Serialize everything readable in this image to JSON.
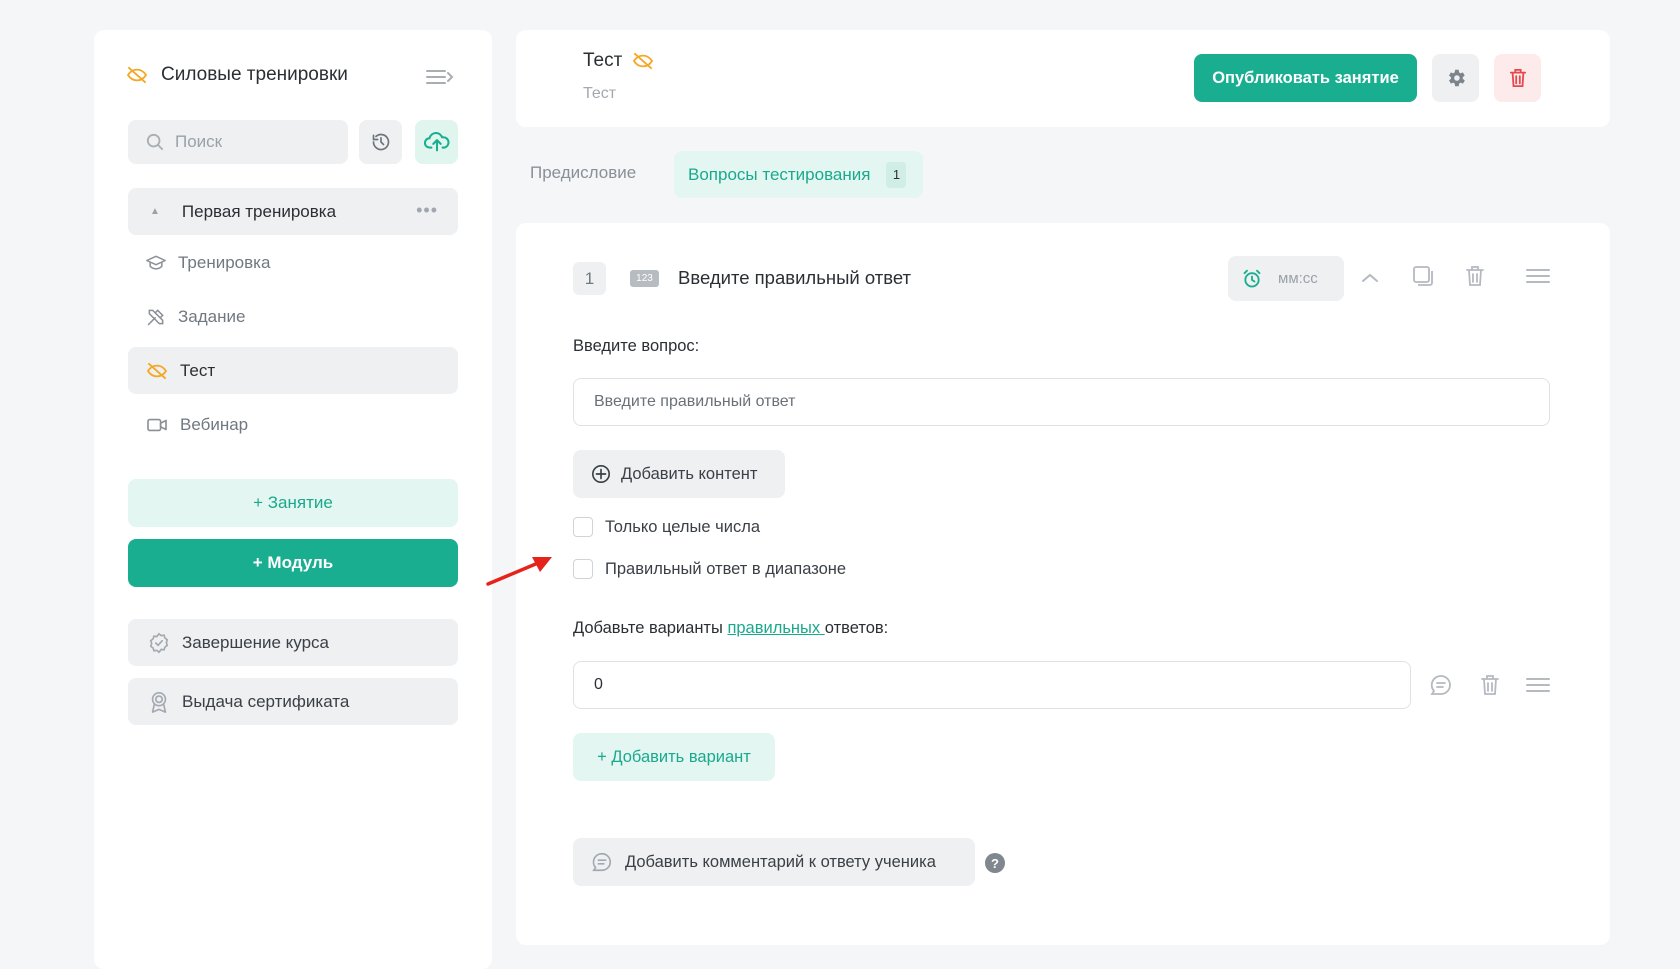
{
  "sidebar": {
    "title": "Силовые тренировки",
    "search_placeholder": "Поиск",
    "module": {
      "label": "Первая тренировка",
      "more": "•••"
    },
    "lessons": [
      {
        "label": "Тренировка",
        "icon": "graduation-cap-icon"
      },
      {
        "label": "Задание",
        "icon": "tools-icon"
      },
      {
        "label": "Тест",
        "icon": "eye-off-icon",
        "active": true
      },
      {
        "label": "Вебинар",
        "icon": "video-icon"
      }
    ],
    "add_lesson": "+ Занятие",
    "add_module": "+ Модуль",
    "extras": [
      {
        "label": "Завершение курса",
        "icon": "check-badge-icon"
      },
      {
        "label": "Выдача сертификата",
        "icon": "award-icon"
      }
    ]
  },
  "header": {
    "title": "Тест",
    "subtitle": "Тест",
    "publish_label": "Опубликовать занятие"
  },
  "tabs": [
    {
      "label": "Предисловие"
    },
    {
      "label": "Вопросы тестирования",
      "count": "1",
      "active": true
    }
  ],
  "question": {
    "number": "1",
    "type_badge": "123",
    "title": "Введите правильный ответ",
    "timer_placeholder": "мм:сс",
    "question_label": "Введите вопрос:",
    "question_value": "Введите правильный ответ",
    "add_content_label": "Добавить контент",
    "options": [
      {
        "label": "Только целые числа",
        "checked": false
      },
      {
        "label": "Правильный ответ в диапазоне",
        "checked": false
      }
    ],
    "variants_label_prefix": "Добавьте варианты ",
    "variants_label_link": "правильных ",
    "variants_label_suffix": "ответов:",
    "answer_value": "0",
    "add_variant_label": "+ Добавить вариант",
    "add_comment_label": "Добавить комментарий к ответу ученика",
    "help_label": "?"
  },
  "colors": {
    "accent": "#1aae90",
    "accent_light": "#e4f6f1",
    "warning_icon": "#f5a623",
    "danger": "#e5484d",
    "arrow": "#e5231b"
  }
}
